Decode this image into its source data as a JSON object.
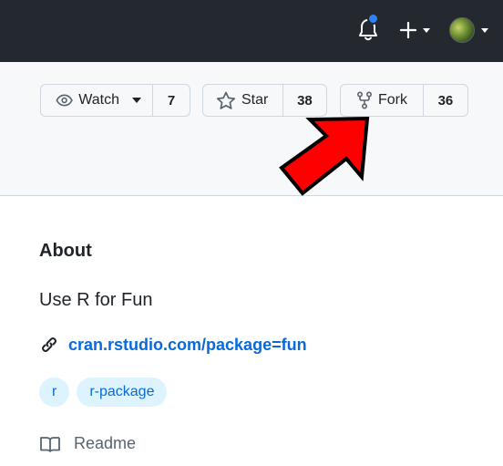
{
  "header": {
    "notifications_icon": "bell-icon",
    "notification_indicator_color": "#2f81f7",
    "create_menu_icon": "plus-icon",
    "avatar_icon": "user-avatar"
  },
  "repo_actions": {
    "watch": {
      "label": "Watch",
      "count": "7",
      "icon": "eye-icon"
    },
    "star": {
      "label": "Star",
      "count": "38",
      "icon": "star-icon"
    },
    "fork": {
      "label": "Fork",
      "count": "36",
      "icon": "repo-forked-icon"
    }
  },
  "annotation": {
    "icon": "red-arrow",
    "color": "#ff0000"
  },
  "about": {
    "title": "About",
    "description": "Use R for Fun",
    "link_text": "cran.rstudio.com/package=fun",
    "link_icon": "link-icon",
    "topics": [
      "r",
      "r-package"
    ],
    "readme_label": "Readme",
    "readme_icon": "book-icon"
  },
  "colors": {
    "header_bg": "#24292f",
    "link": "#0969da",
    "topic_bg": "#ddf4ff"
  }
}
